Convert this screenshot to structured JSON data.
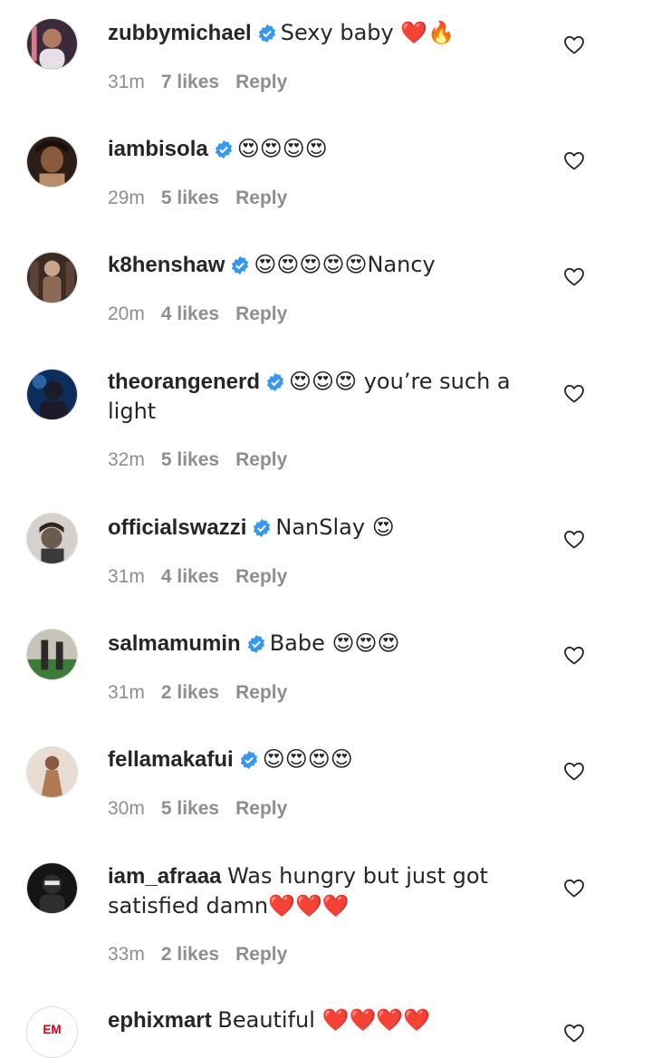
{
  "comments": [
    {
      "username": "zubbymichael",
      "verified": true,
      "text": "Sexy baby ❤️🔥",
      "time": "31m",
      "likes": "7 likes",
      "reply": "Reply",
      "avatar_colors": [
        "#3a2a3a",
        "#d97a8a"
      ]
    },
    {
      "username": "iambisola",
      "verified": true,
      "text": "😍😍😍😍",
      "time": "29m",
      "likes": "5 likes",
      "reply": "Reply",
      "avatar_colors": [
        "#2b1d18",
        "#b98c6e"
      ]
    },
    {
      "username": "k8henshaw",
      "verified": true,
      "text": "😍😍😍😍😍Nancy",
      "time": "20m",
      "likes": "4 likes",
      "reply": "Reply",
      "avatar_colors": [
        "#3b2b22",
        "#c7a48a"
      ]
    },
    {
      "username": "theorangenerd",
      "verified": true,
      "text": "😍😍😍 you’re such a light",
      "time": "32m",
      "likes": "5 likes",
      "reply": "Reply",
      "avatar_colors": [
        "#0d2e5c",
        "#3f86d0"
      ]
    },
    {
      "username": "officialswazzi",
      "verified": true,
      "text": "NanSlay 😍",
      "time": "31m",
      "likes": "4 likes",
      "reply": "Reply",
      "avatar_colors": [
        "#d5d0cc",
        "#6b5a50"
      ]
    },
    {
      "username": "salmamumin",
      "verified": true,
      "text": "Babe 😍😍😍",
      "time": "31m",
      "likes": "2 likes",
      "reply": "Reply",
      "avatar_colors": [
        "#3e7a3a",
        "#c8c3b8"
      ]
    },
    {
      "username": "fellamakafui",
      "verified": true,
      "text": "😍😍😍😍",
      "time": "30m",
      "likes": "5 likes",
      "reply": "Reply",
      "avatar_colors": [
        "#e9ddd3",
        "#b07a55"
      ]
    },
    {
      "username": "iam_afraaa",
      "verified": false,
      "text": "Was hungry but just got satisfied damn❤️❤️❤️",
      "time": "33m",
      "likes": "2 likes",
      "reply": "Reply",
      "avatar_colors": [
        "#151515",
        "#e6e6e6"
      ]
    },
    {
      "username": "ephixmart",
      "verified": false,
      "text": "Beautiful ❤️❤️❤️❤️",
      "time": "",
      "likes": "",
      "reply": "",
      "avatar_colors": [
        "#ffffff",
        "#d0021b"
      ]
    }
  ],
  "colors": {
    "verified": "#3897f0",
    "meta": "#8e8e8e",
    "text": "#262626"
  }
}
